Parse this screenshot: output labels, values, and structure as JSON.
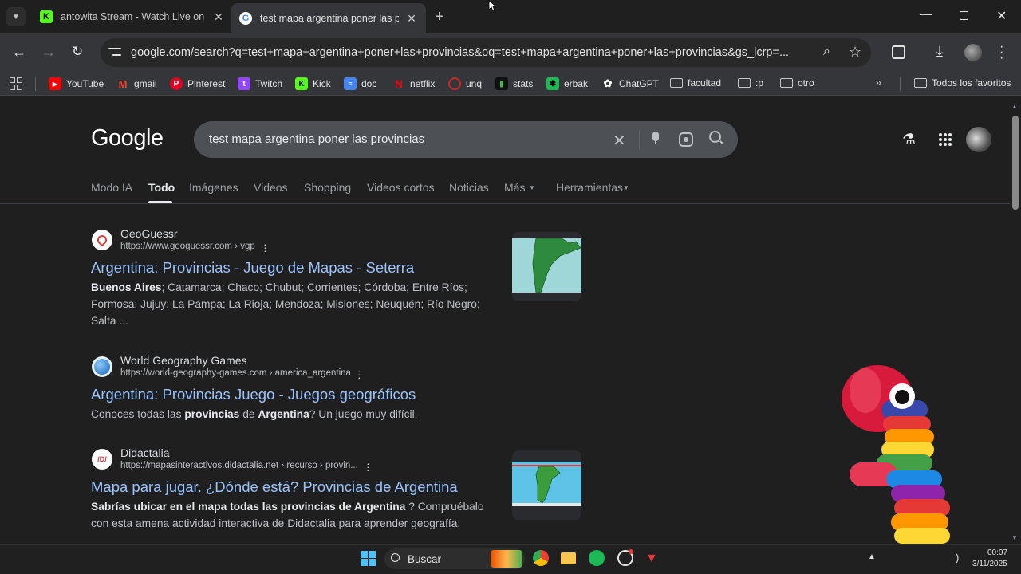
{
  "browser": {
    "tabs": [
      {
        "title": "antowita Stream - Watch Live on K",
        "favicon": "kick-logo-icon"
      },
      {
        "title": "test mapa argentina poner las pro",
        "favicon": "google-logo-icon",
        "active": true
      }
    ],
    "url": "google.com/search?q=test+mapa+argentina+poner+las+provincias&oq=test+mapa+argentina+poner+las+provincias&gs_lcrp=...",
    "bookmarks": [
      {
        "label": "YouTube",
        "icon": "youtube-icon",
        "color": "#ff0000"
      },
      {
        "label": "gmail",
        "icon": "gmail-icon",
        "color": "#ea4335"
      },
      {
        "label": "Pinterest",
        "icon": "pinterest-icon",
        "color": "#e60023"
      },
      {
        "label": "Twitch",
        "icon": "twitch-icon",
        "color": "#9146ff"
      },
      {
        "label": "Kick",
        "icon": "kick-icon",
        "color": "#53fc18"
      },
      {
        "label": "doc",
        "icon": "docs-icon",
        "color": "#4285f4"
      },
      {
        "label": "netflix",
        "icon": "netflix-icon",
        "color": "#e50914"
      },
      {
        "label": "unq",
        "icon": "unq-icon",
        "color": "#c62828"
      },
      {
        "label": "stats",
        "icon": "stats-icon",
        "color": "#2e7d32"
      },
      {
        "label": "erbak",
        "icon": "erbak-icon",
        "color": "#1db954"
      },
      {
        "label": "ChatGPT",
        "icon": "chatgpt-icon",
        "color": "#ffffff"
      },
      {
        "label": "facultad",
        "icon": "folder-icon"
      },
      {
        "label": ":p",
        "icon": "folder-icon"
      },
      {
        "label": "otro",
        "icon": "folder-icon"
      }
    ],
    "all_bookmarks_label": "Todos los favoritos"
  },
  "google": {
    "logo": "Google",
    "query": "test mapa argentina poner las provincias",
    "tabs": [
      "Modo IA",
      "Todo",
      "Imágenes",
      "Videos",
      "Shopping",
      "Videos cortos",
      "Noticias",
      "Más",
      "Herramientas"
    ],
    "active_tab": "Todo",
    "results": [
      {
        "site": "GeoGuessr",
        "cite": "https://www.geoguessr.com › vgp",
        "title": "Argentina: Provincias - Juego de Mapas - Seterra",
        "snippet_bold": "Buenos Aires",
        "snippet": "; Catamarca; Chaco; Chubut; Corrientes; Córdoba; Entre Ríos; Formosa; Jujuy; La Pampa; La Rioja; Mendoza; Misiones; Neuquén; Río Negro; Salta ..."
      },
      {
        "site": "World Geography Games",
        "cite": "https://world-geography-games.com › america_argentina",
        "title": "Argentina: Provincias Juego - Juegos geográficos",
        "snippet_parts": [
          "Conoces todas las ",
          "provincias",
          " de ",
          "Argentina",
          "? Un juego muy difícil."
        ]
      },
      {
        "site": "Didactalia",
        "cite": "https://mapasinteractivos.didactalia.net › recurso › provin...",
        "title": "Mapa para jugar. ¿Dónde está? Provincias de Argentina",
        "snippet_bold": "Sabrías ubicar en el mapa todas las provincias de Argentina",
        "snippet": " ? Compruébalo con esta amena actividad interactiva de Didactalia para aprender geografía."
      }
    ]
  },
  "taskbar": {
    "search_label": "Buscar",
    "time": "00:07",
    "date": "3/11/2025"
  }
}
